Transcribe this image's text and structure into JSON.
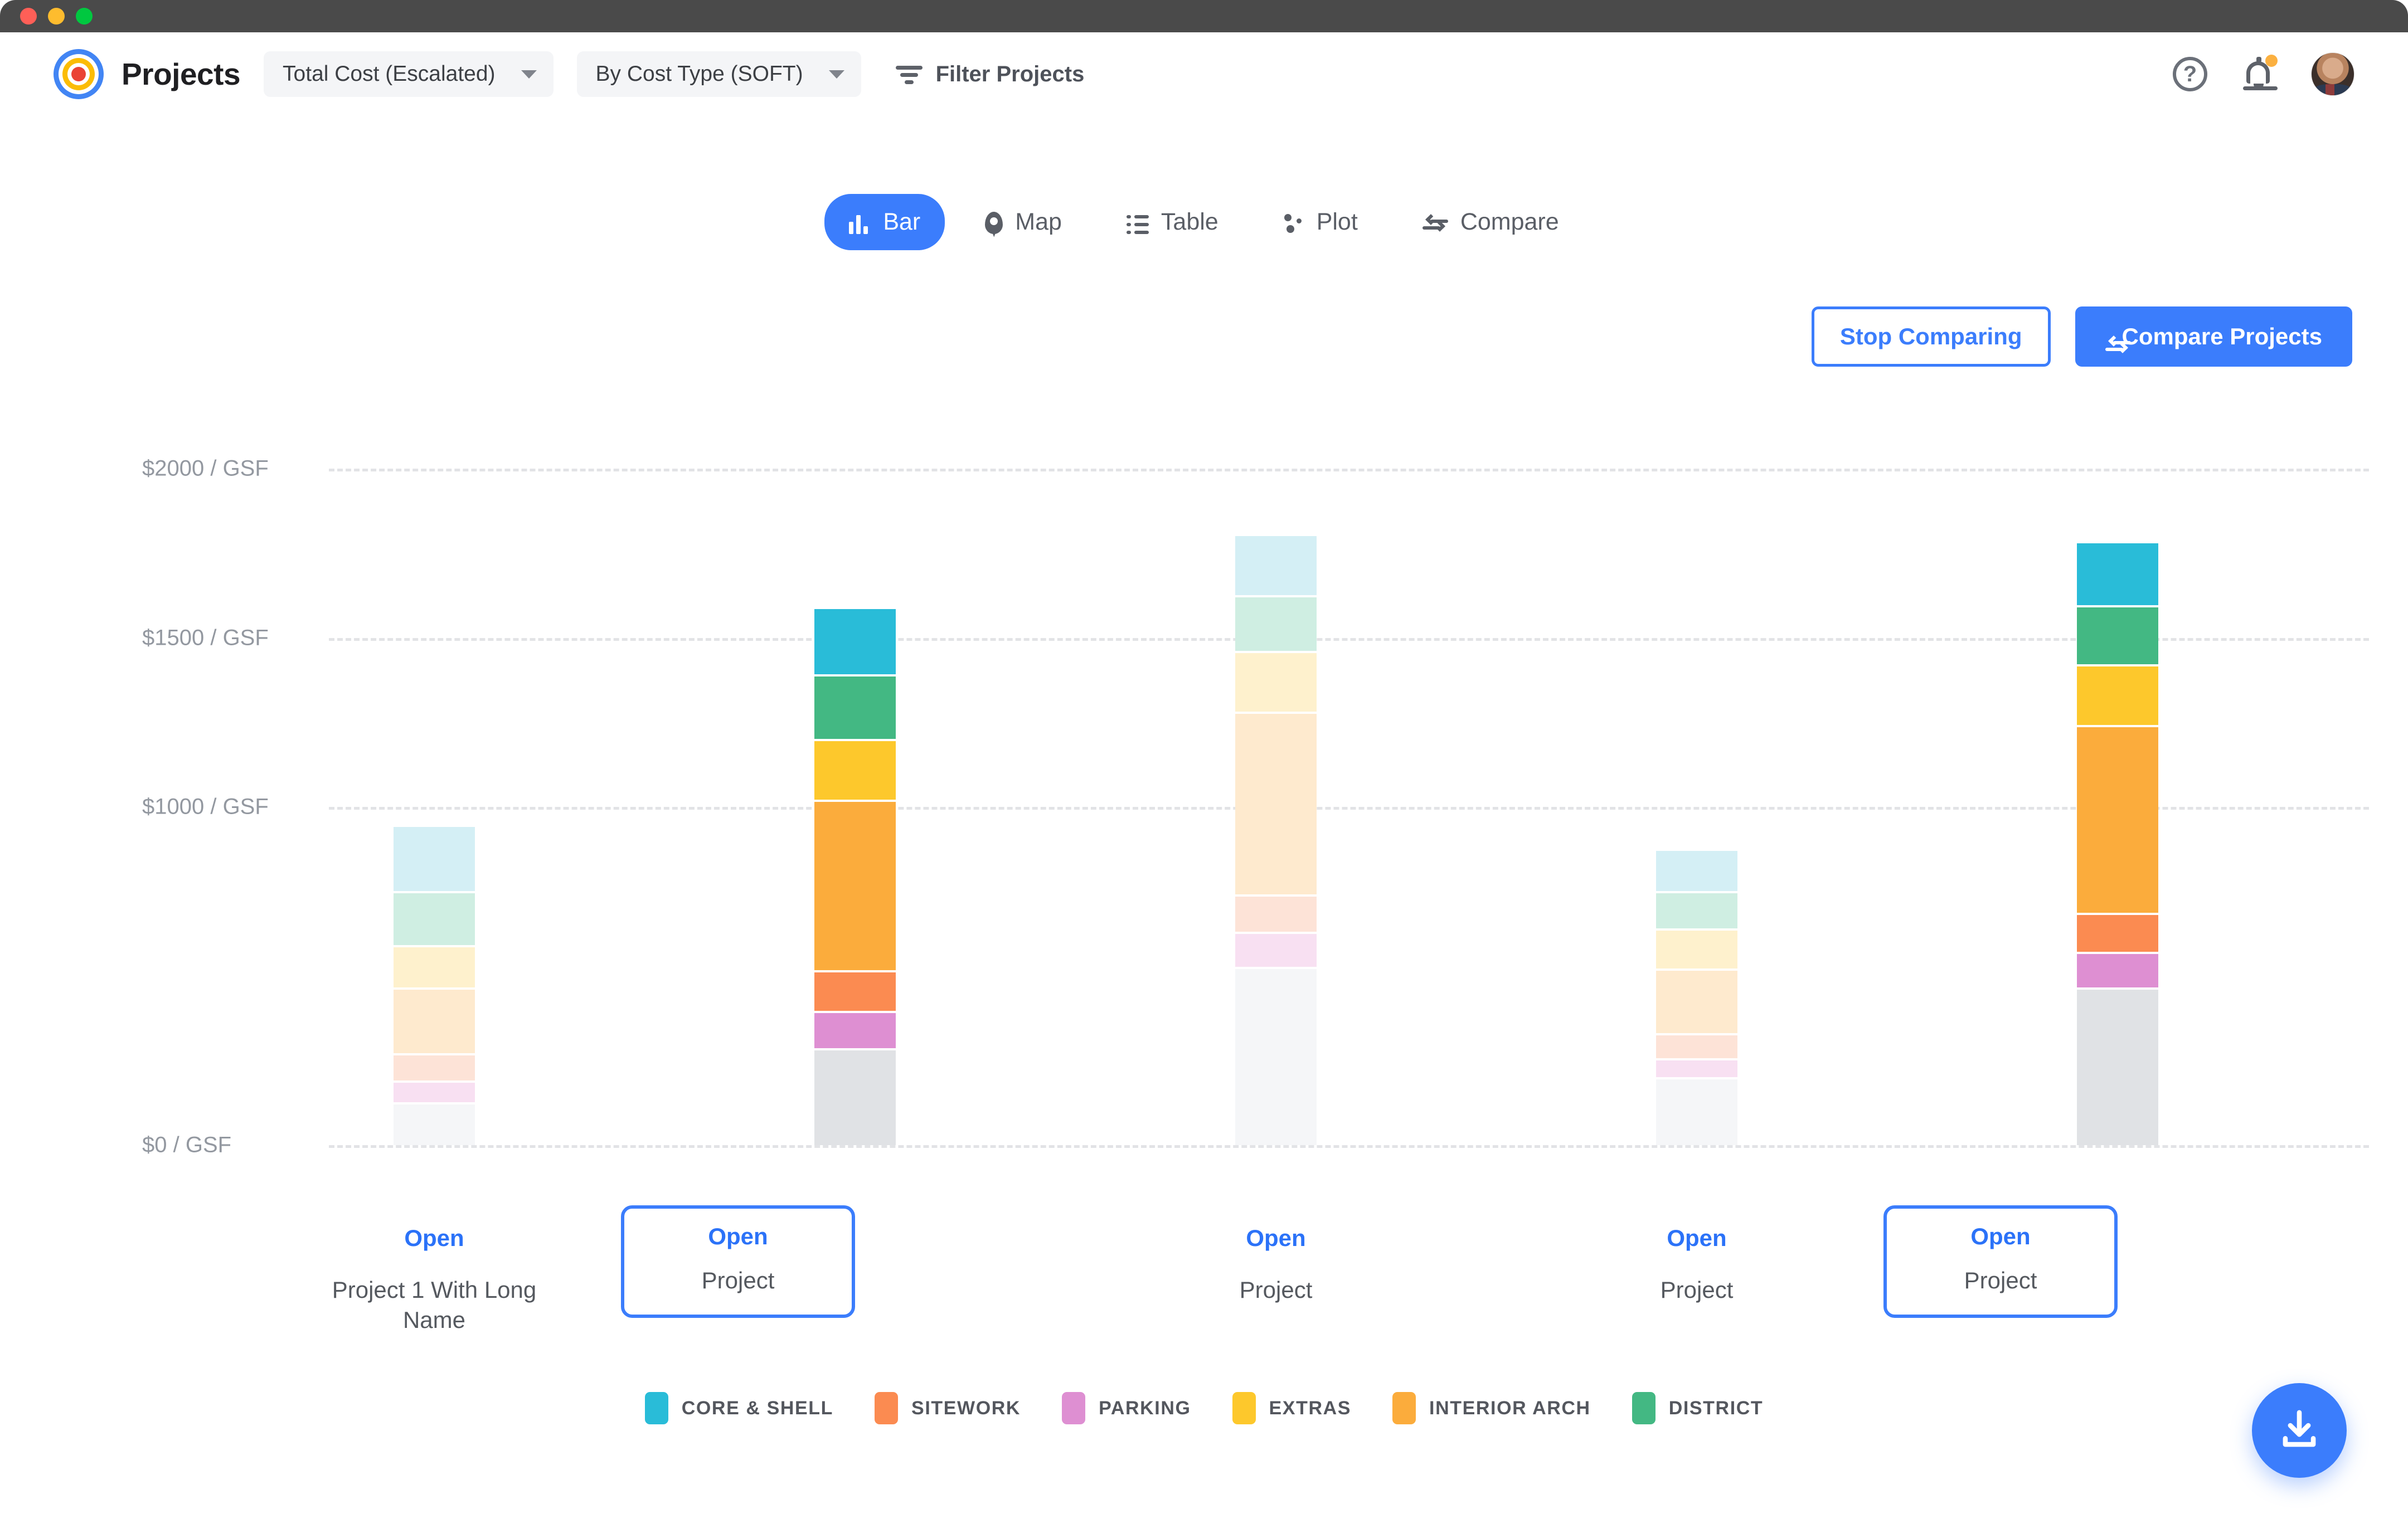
{
  "window": {
    "traffic_lights": [
      "close-red",
      "minimize-yellow",
      "maximize-green"
    ]
  },
  "header": {
    "logo_icon": "bullseye-target-logo",
    "title": "Projects",
    "dropdowns": [
      {
        "name": "metric-select",
        "value": "Total Cost (Escalated)",
        "caret_icon": "chevron-down-icon"
      },
      {
        "name": "grouping-select",
        "value": "By Cost Type (SOFT)",
        "caret_icon": "chevron-down-icon"
      }
    ],
    "filter": {
      "icon": "filter-icon",
      "label": "Filter Projects"
    },
    "help_icon": "help-question-icon",
    "help_glyph": "?",
    "notification_icon": "bell-icon",
    "notification_badge": true,
    "avatar": "user-avatar-photo"
  },
  "tabs": [
    {
      "label": "Bar",
      "icon": "bar-chart-icon",
      "active": true
    },
    {
      "label": "Map",
      "icon": "map-pin-icon",
      "active": false
    },
    {
      "label": "Table",
      "icon": "table-list-icon",
      "active": false
    },
    {
      "label": "Plot",
      "icon": "scatter-plot-icon",
      "active": false
    },
    {
      "label": "Compare",
      "icon": "compare-arrows-icon",
      "active": false
    }
  ],
  "actions": {
    "stop_comparing": "Stop Comparing",
    "compare_projects": "Compare Projects",
    "compare_icon": "compare-arrows-icon"
  },
  "fab": {
    "icon": "download-icon",
    "name": "download-button"
  },
  "colors": {
    "accent_blue": "#3b7dfc",
    "link_blue": "#2b72f8",
    "core_shell": "#29bcd8",
    "sitework": "#fb8b51",
    "parking": "#de8fd2",
    "extras": "#fdc82c",
    "interior_arch": "#fbac3c",
    "district": "#43b883",
    "other_gray": "#e0e2e5",
    "faded_core_shell": "#d4eff5",
    "faded_sitework": "#fde3d7",
    "faded_parking": "#f8e0f2",
    "faded_extras": "#fef1cd",
    "faded_interior_arch": "#feeace",
    "faded_district": "#cfeee2",
    "faded_other_gray": "#f5f6f8",
    "gridline": "#e2e3e6",
    "axis_text": "#9398a0"
  },
  "chart_data": {
    "type": "bar",
    "subtype": "stacked",
    "title": "",
    "xlabel": "",
    "ylabel": "",
    "ylim": [
      0,
      2000
    ],
    "grid": true,
    "unit": "$ / GSF",
    "y_ticks": [
      {
        "value": 2000,
        "label": "$2000 / GSF"
      },
      {
        "value": 1500,
        "label": "$1500 / GSF"
      },
      {
        "value": 1000,
        "label": "$1000 / GSF"
      },
      {
        "value": 0,
        "label": "$0 / GSF"
      }
    ],
    "legend_position": "bottom",
    "legend": [
      {
        "key": "core_shell",
        "label": "CORE & SHELL",
        "color": "#29bcd8"
      },
      {
        "key": "sitework",
        "label": "SITEWORK",
        "color": "#fb8b51"
      },
      {
        "key": "parking",
        "label": "PARKING",
        "color": "#de8fd2"
      },
      {
        "key": "extras",
        "label": "EXTRAS",
        "color": "#fdc82c"
      },
      {
        "key": "interior_arch",
        "label": "INTERIOR ARCH",
        "color": "#fbac3c"
      },
      {
        "key": "district",
        "label": "DISTRICT",
        "color": "#43b883"
      }
    ],
    "stack_order_top_to_bottom": [
      "core_shell",
      "district",
      "extras",
      "interior_arch",
      "sitework",
      "parking",
      "other"
    ],
    "categories": [
      "Project 1 With Long Name",
      "Project",
      "Project",
      "Project",
      "Project"
    ],
    "bars": [
      {
        "name": "Project 1 With Long Name",
        "open_label": "Open",
        "selected": false,
        "total": 940,
        "segments": [
          {
            "key": "core_shell",
            "value": 195
          },
          {
            "key": "district",
            "value": 160
          },
          {
            "key": "extras",
            "value": 125
          },
          {
            "key": "interior_arch",
            "value": 195
          },
          {
            "key": "sitework",
            "value": 80
          },
          {
            "key": "parking",
            "value": 65
          },
          {
            "key": "other",
            "value": 120
          }
        ]
      },
      {
        "name": "Project",
        "open_label": "Open",
        "selected": true,
        "total": 1585,
        "segments": [
          {
            "key": "core_shell",
            "value": 200
          },
          {
            "key": "district",
            "value": 190
          },
          {
            "key": "extras",
            "value": 180
          },
          {
            "key": "interior_arch",
            "value": 505
          },
          {
            "key": "sitework",
            "value": 120
          },
          {
            "key": "parking",
            "value": 110
          },
          {
            "key": "other",
            "value": 280
          }
        ]
      },
      {
        "name": "Project",
        "open_label": "Open",
        "selected": false,
        "total": 1800,
        "segments": [
          {
            "key": "core_shell",
            "value": 180
          },
          {
            "key": "district",
            "value": 165
          },
          {
            "key": "extras",
            "value": 180
          },
          {
            "key": "interior_arch",
            "value": 540
          },
          {
            "key": "sitework",
            "value": 110
          },
          {
            "key": "parking",
            "value": 105
          },
          {
            "key": "other",
            "value": 520
          }
        ]
      },
      {
        "name": "Project",
        "open_label": "Open",
        "selected": false,
        "total": 870,
        "segments": [
          {
            "key": "core_shell",
            "value": 125
          },
          {
            "key": "district",
            "value": 110
          },
          {
            "key": "extras",
            "value": 120
          },
          {
            "key": "interior_arch",
            "value": 190
          },
          {
            "key": "sitework",
            "value": 75
          },
          {
            "key": "parking",
            "value": 55
          },
          {
            "key": "other",
            "value": 195
          }
        ]
      },
      {
        "name": "Project",
        "open_label": "Open",
        "selected": true,
        "total": 1780,
        "segments": [
          {
            "key": "core_shell",
            "value": 190
          },
          {
            "key": "district",
            "value": 175
          },
          {
            "key": "extras",
            "value": 180
          },
          {
            "key": "interior_arch",
            "value": 555
          },
          {
            "key": "sitework",
            "value": 115
          },
          {
            "key": "parking",
            "value": 105
          },
          {
            "key": "other",
            "value": 460
          }
        ]
      }
    ]
  }
}
